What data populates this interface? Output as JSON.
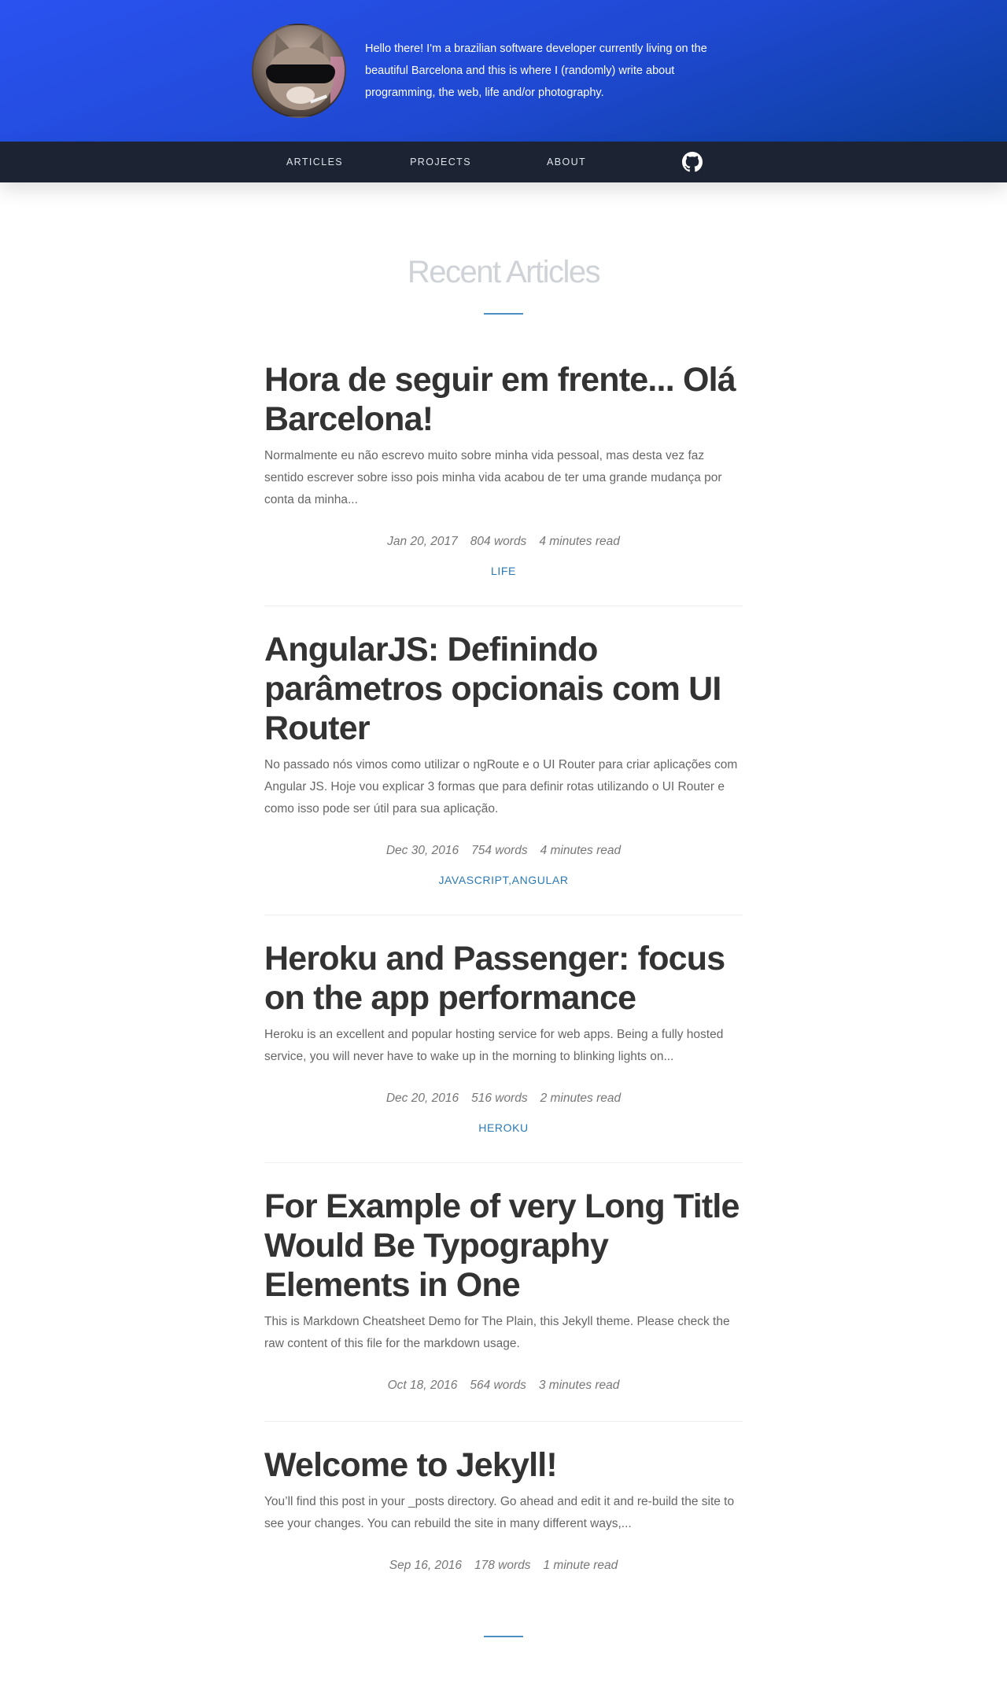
{
  "header": {
    "intro": "Hello there! I'm a brazilian software developer currently living on the beautiful Barcelona and this is where I (randomly) write about programming, the web, life and/or photography.",
    "gradient_start": "#2a52f0",
    "gradient_end": "#0b3e9c"
  },
  "nav": {
    "items": [
      {
        "label": "ARTICLES"
      },
      {
        "label": "PROJECTS"
      },
      {
        "label": "ABOUT"
      }
    ],
    "github_icon": "github-icon"
  },
  "main": {
    "section_title": "Recent Articles",
    "articles": [
      {
        "title": "Hora de seguir em frente... Olá Barcelona!",
        "excerpt": "Normalmente eu não escrevo muito sobre minha vida pessoal, mas desta vez faz sentido escrever sobre isso pois minha vida acabou de ter uma grande mudança por conta da minha...",
        "date": "Jan 20, 2017",
        "words": "804 words",
        "read_time": "4 minutes read",
        "tags": "LIFE"
      },
      {
        "title": "AngularJS: Definindo parâmetros opcionais com UI Router",
        "excerpt": "No passado nós vimos como utilizar o ngRoute e o UI Router para criar aplicações com Angular JS. Hoje vou explicar 3 formas que para definir rotas utilizando o UI Router e como isso pode ser útil para sua aplicação.",
        "date": "Dec 30, 2016",
        "words": "754 words",
        "read_time": "4 minutes read",
        "tags": "JAVASCRIPT,ANGULAR"
      },
      {
        "title": "Heroku and Passenger: focus on the app performance",
        "excerpt": "Heroku is an excellent and popular hosting service for web apps. Being a fully hosted service, you will never have to wake up in the morning to blinking lights on...",
        "date": "Dec 20, 2016",
        "words": "516 words",
        "read_time": "2 minutes read",
        "tags": "HEROKU"
      },
      {
        "title": "For Example of very Long Title Would Be Typography Elements in One",
        "excerpt": "This is Markdown Cheatsheet Demo for The Plain, this Jekyll theme. Please check the raw content of this file for the markdown usage.",
        "date": "Oct 18, 2016",
        "words": "564 words",
        "read_time": "3 minutes read"
      },
      {
        "title": "Welcome to Jekyll!",
        "excerpt": "You’ll find this post in your _posts directory. Go ahead and edit it and re-build the site to see your changes. You can rebuild the site in many different ways,...",
        "date": "Sep 16, 2016",
        "words": "178 words",
        "read_time": "1 minute read"
      }
    ]
  },
  "colors": {
    "nav_bg": "#1c2333",
    "accent": "#2a7ab6",
    "rule": "#4a90c4"
  }
}
